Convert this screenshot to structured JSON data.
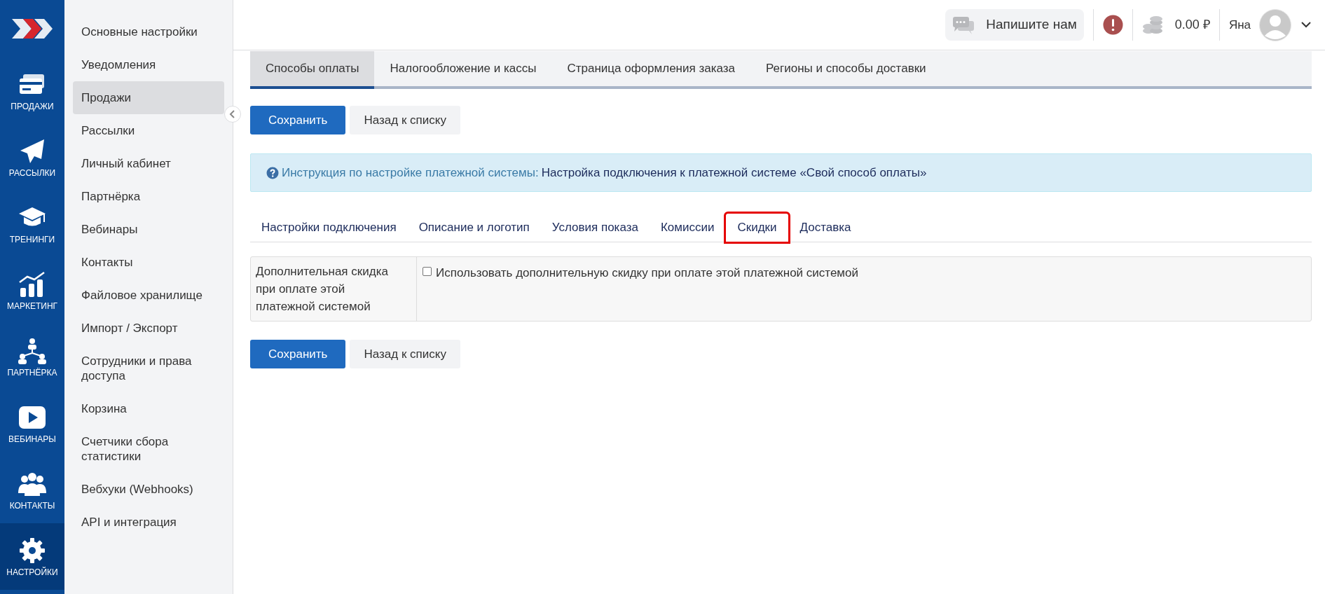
{
  "rail": {
    "items": [
      {
        "label": "ПРОДАЖИ",
        "selected": false
      },
      {
        "label": "РАССЫЛКИ",
        "selected": false
      },
      {
        "label": "ТРЕНИНГИ",
        "selected": false
      },
      {
        "label": "МАРКЕТИНГ",
        "selected": false
      },
      {
        "label": "ПАРТНЁРКА",
        "selected": false
      },
      {
        "label": "ВЕБИНАРЫ",
        "selected": false
      },
      {
        "label": "КОНТАКТЫ",
        "selected": false
      },
      {
        "label": "НАСТРОЙКИ",
        "selected": true
      }
    ]
  },
  "sidebar": {
    "items": [
      {
        "label": "Основные настройки",
        "selected": false
      },
      {
        "label": "Уведомления",
        "selected": false
      },
      {
        "label": "Продажи",
        "selected": true
      },
      {
        "label": "Рассылки",
        "selected": false
      },
      {
        "label": "Личный кабинет",
        "selected": false
      },
      {
        "label": "Партнёрка",
        "selected": false
      },
      {
        "label": "Вебинары",
        "selected": false
      },
      {
        "label": "Контакты",
        "selected": false
      },
      {
        "label": "Файловое хранилище",
        "selected": false
      },
      {
        "label": "Импорт / Экспорт",
        "selected": false
      },
      {
        "label": "Сотрудники и права доступа",
        "selected": false
      },
      {
        "label": "Корзина",
        "selected": false
      },
      {
        "label": "Счетчики сбора статистики",
        "selected": false
      },
      {
        "label": "Вебхуки (Webhooks)",
        "selected": false
      },
      {
        "label": "API и интеграция",
        "selected": false
      }
    ]
  },
  "header": {
    "chat_button": "Напишите нам",
    "balance": "0.00 ₽",
    "user_name": "Яна"
  },
  "tabs": [
    {
      "label": "Способы оплаты",
      "selected": true
    },
    {
      "label": "Налогообложение и кассы",
      "selected": false
    },
    {
      "label": "Страница оформления заказа",
      "selected": false
    },
    {
      "label": "Регионы и способы доставки",
      "selected": false
    }
  ],
  "actions_top": {
    "save": "Сохранить",
    "back": "Назад к списку"
  },
  "info": {
    "label": "Инструкция по настройке платежной системы:",
    "link": "Настройка подключения к платежной системе «Свой способ оплаты»"
  },
  "subtabs": [
    {
      "label": "Настройки подключения",
      "selected": false,
      "highlighted": false
    },
    {
      "label": "Описание и логотип",
      "selected": false,
      "highlighted": false
    },
    {
      "label": "Условия показа",
      "selected": false,
      "highlighted": false
    },
    {
      "label": "Комиссии",
      "selected": false,
      "highlighted": false
    },
    {
      "label": "Скидки",
      "selected": true,
      "highlighted": true
    },
    {
      "label": "Доставка",
      "selected": false,
      "highlighted": false
    }
  ],
  "form": {
    "label": "Дополнительная скидка при оплате этой платежной системой",
    "checkbox": {
      "label": "Использовать дополнительную скидку при оплате этой платежной системой",
      "checked": false
    }
  },
  "actions_bottom": {
    "save": "Сохранить",
    "back": "Назад к списку"
  }
}
